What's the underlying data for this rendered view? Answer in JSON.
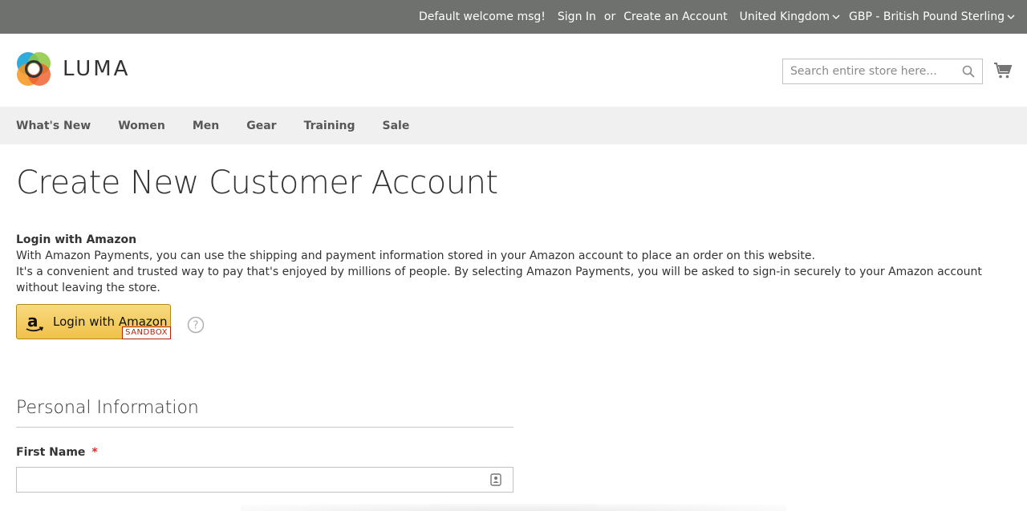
{
  "topbar": {
    "welcome": "Default welcome msg!",
    "sign_in": "Sign In",
    "or": "or",
    "create_account": "Create an Account",
    "store": "United Kingdom",
    "currency": "GBP - British Pound Sterling"
  },
  "header": {
    "logo_text": "LUMA",
    "search_placeholder": "Search entire store here...",
    "icons": [
      "search-icon",
      "cart-icon"
    ]
  },
  "nav": {
    "items": [
      "What's New",
      "Women",
      "Men",
      "Gear",
      "Training",
      "Sale"
    ]
  },
  "main": {
    "title": "Create New Customer Account",
    "amazon": {
      "title": "Login with Amazon",
      "line1": "With Amazon Payments, you can use the shipping and payment information stored in your Amazon account to place an order on this website.",
      "line2": "It's a convenient and trusted way to pay that's enjoyed by millions of people. By selecting Amazon Payments, you will be asked to sign-in securely to your Amazon account without leaving the store.",
      "button_label": "Login with Amazon",
      "badge": "SANDBOX"
    },
    "personal": {
      "title": "Personal Information",
      "first_name_label": "First Name",
      "required_mark": "*",
      "first_name_value": ""
    }
  },
  "colors": {
    "topbar_bg": "#6e716e",
    "nav_bg": "#f0f0f0",
    "amazon_button": "#f0c14b",
    "required": "#e02b27"
  }
}
